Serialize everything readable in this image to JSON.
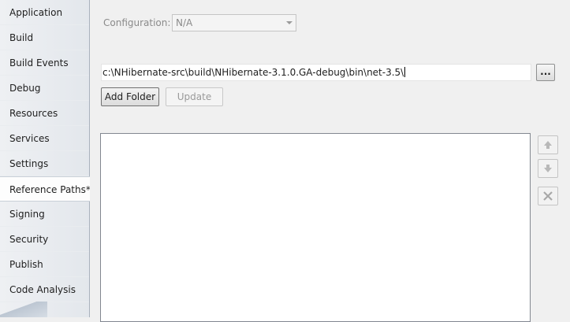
{
  "sidebar": {
    "items": [
      {
        "label": "Application"
      },
      {
        "label": "Build"
      },
      {
        "label": "Build Events"
      },
      {
        "label": "Debug"
      },
      {
        "label": "Resources"
      },
      {
        "label": "Services"
      },
      {
        "label": "Settings"
      },
      {
        "label": "Reference Paths*"
      },
      {
        "label": "Signing"
      },
      {
        "label": "Security"
      },
      {
        "label": "Publish"
      },
      {
        "label": "Code Analysis"
      }
    ],
    "active_index": 7
  },
  "config": {
    "label": "Configuration:",
    "value": "N/A"
  },
  "folder": {
    "value": "c:\\NHibernate-src\\build\\NHibernate-3.1.0.GA-debug\\bin\\net-3.5\\",
    "browse_label": "..."
  },
  "buttons": {
    "add_folder": "Add Folder",
    "update": "Update"
  },
  "reference_paths": [],
  "icons": {
    "move_up": "arrow-up-icon",
    "move_down": "arrow-down-icon",
    "remove": "close-icon"
  }
}
